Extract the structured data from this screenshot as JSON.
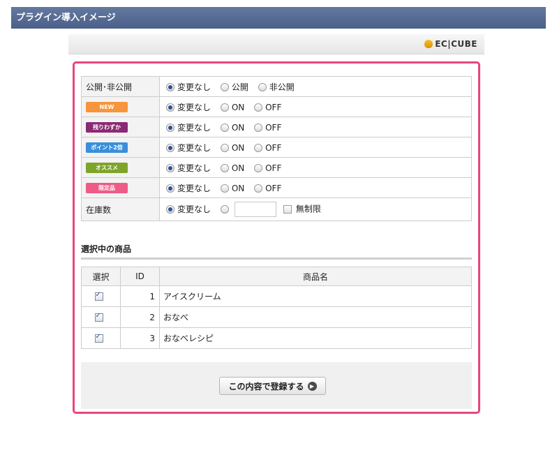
{
  "header": {
    "title": "プラグイン導入イメージ"
  },
  "logo": {
    "text": "EC|CUBE"
  },
  "colors": {
    "frame_border": "#e8467c",
    "badge_new": "#f6953b",
    "badge_low": "#8b2a74",
    "badge_point": "#3a8fdb",
    "badge_recommend": "#7ea52a",
    "badge_limited": "#ee5b86"
  },
  "settings": {
    "rows": [
      {
        "label": "公開･非公開",
        "options": [
          "変更なし",
          "公開",
          "非公開"
        ]
      },
      {
        "badge": "NEW",
        "options": [
          "変更なし",
          "ON",
          "OFF"
        ]
      },
      {
        "badge": "残りわずか",
        "options": [
          "変更なし",
          "ON",
          "OFF"
        ]
      },
      {
        "badge": "ポイント2倍",
        "options": [
          "変更なし",
          "ON",
          "OFF"
        ]
      },
      {
        "badge": "オススメ",
        "options": [
          "変更なし",
          "ON",
          "OFF"
        ]
      },
      {
        "badge": "限定品",
        "options": [
          "変更なし",
          "ON",
          "OFF"
        ]
      }
    ],
    "stock": {
      "label": "在庫数",
      "option_unchanged": "変更なし",
      "input_value": "",
      "unlimited_label": "無制限"
    }
  },
  "selected": {
    "title": "選択中の商品",
    "columns": {
      "select": "選択",
      "id": "ID",
      "name": "商品名"
    },
    "rows": [
      {
        "id": "1",
        "name": "アイスクリーム"
      },
      {
        "id": "2",
        "name": "おなべ"
      },
      {
        "id": "3",
        "name": "おなべレシピ"
      }
    ]
  },
  "submit": {
    "label": "この内容で登録する"
  }
}
